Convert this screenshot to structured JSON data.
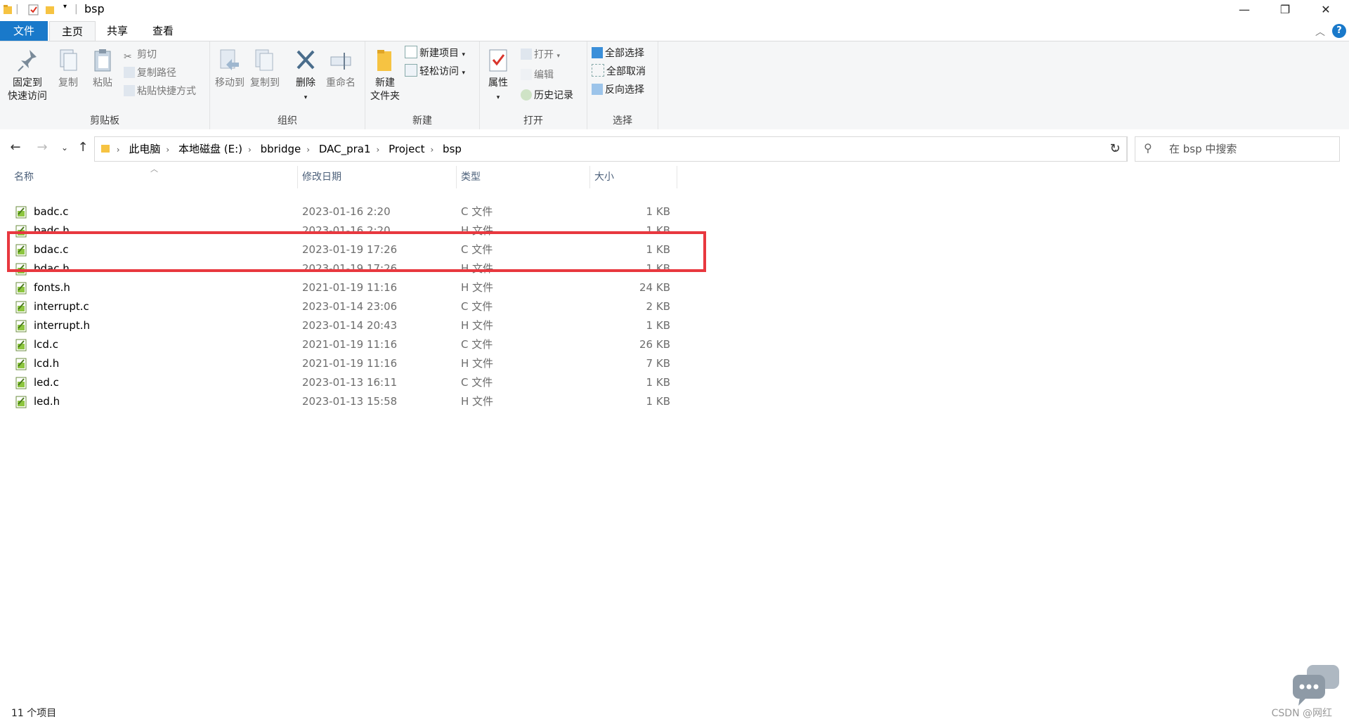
{
  "window": {
    "title": "bsp",
    "minimize": "—",
    "restore": "❐",
    "close": "✕"
  },
  "tabs": {
    "file": "文件",
    "home": "主页",
    "share": "共享",
    "view": "查看",
    "help": "?"
  },
  "ribbon": {
    "clipboard": {
      "label": "剪贴板",
      "pin": "固定到\n快速访问",
      "pin_line1": "固定到",
      "pin_line2": "快速访问",
      "copy": "复制",
      "paste": "粘贴",
      "cut": "剪切",
      "copy_path": "复制路径",
      "paste_shortcut": "粘贴快捷方式"
    },
    "organize": {
      "label": "组织",
      "move_to": "移动到",
      "copy_to": "复制到",
      "delete": "删除",
      "rename": "重命名"
    },
    "new": {
      "label": "新建",
      "new_folder_line1": "新建",
      "new_folder_line2": "文件夹",
      "new_item": "新建项目",
      "easy_access": "轻松访问"
    },
    "open": {
      "label": "打开",
      "properties": "属性",
      "open": "打开",
      "edit": "编辑",
      "history": "历史记录"
    },
    "select": {
      "label": "选择",
      "select_all": "全部选择",
      "select_none": "全部取消",
      "invert": "反向选择"
    }
  },
  "address": {
    "crumbs": [
      "此电脑",
      "本地磁盘 (E:)",
      "bbridge",
      "DAC_pra1",
      "Project",
      "bsp"
    ],
    "search_placeholder": "在 bsp 中搜索"
  },
  "columns": {
    "name": "名称",
    "date": "修改日期",
    "type": "类型",
    "size": "大小"
  },
  "files": [
    {
      "name": "badc.c",
      "date": "2023-01-16 2:20",
      "type": "C 文件",
      "size": "1 KB"
    },
    {
      "name": "badc.h",
      "date": "2023-01-16 2:20",
      "type": "H 文件",
      "size": "1 KB"
    },
    {
      "name": "bdac.c",
      "date": "2023-01-19 17:26",
      "type": "C 文件",
      "size": "1 KB"
    },
    {
      "name": "bdac.h",
      "date": "2023-01-19 17:26",
      "type": "H 文件",
      "size": "1 KB"
    },
    {
      "name": "fonts.h",
      "date": "2021-01-19 11:16",
      "type": "H 文件",
      "size": "24 KB"
    },
    {
      "name": "interrupt.c",
      "date": "2023-01-14 23:06",
      "type": "C 文件",
      "size": "2 KB"
    },
    {
      "name": "interrupt.h",
      "date": "2023-01-14 20:43",
      "type": "H 文件",
      "size": "1 KB"
    },
    {
      "name": "lcd.c",
      "date": "2021-01-19 11:16",
      "type": "C 文件",
      "size": "26 KB"
    },
    {
      "name": "lcd.h",
      "date": "2021-01-19 11:16",
      "type": "H 文件",
      "size": "7 KB"
    },
    {
      "name": "led.c",
      "date": "2023-01-13 16:11",
      "type": "C 文件",
      "size": "1 KB"
    },
    {
      "name": "led.h",
      "date": "2023-01-13 15:58",
      "type": "H 文件",
      "size": "1 KB"
    }
  ],
  "status": {
    "count": "11 个项目"
  },
  "watermark": "CSDN @网红",
  "colors": {
    "accent": "#1979ca",
    "highlight": "#e8383f"
  }
}
